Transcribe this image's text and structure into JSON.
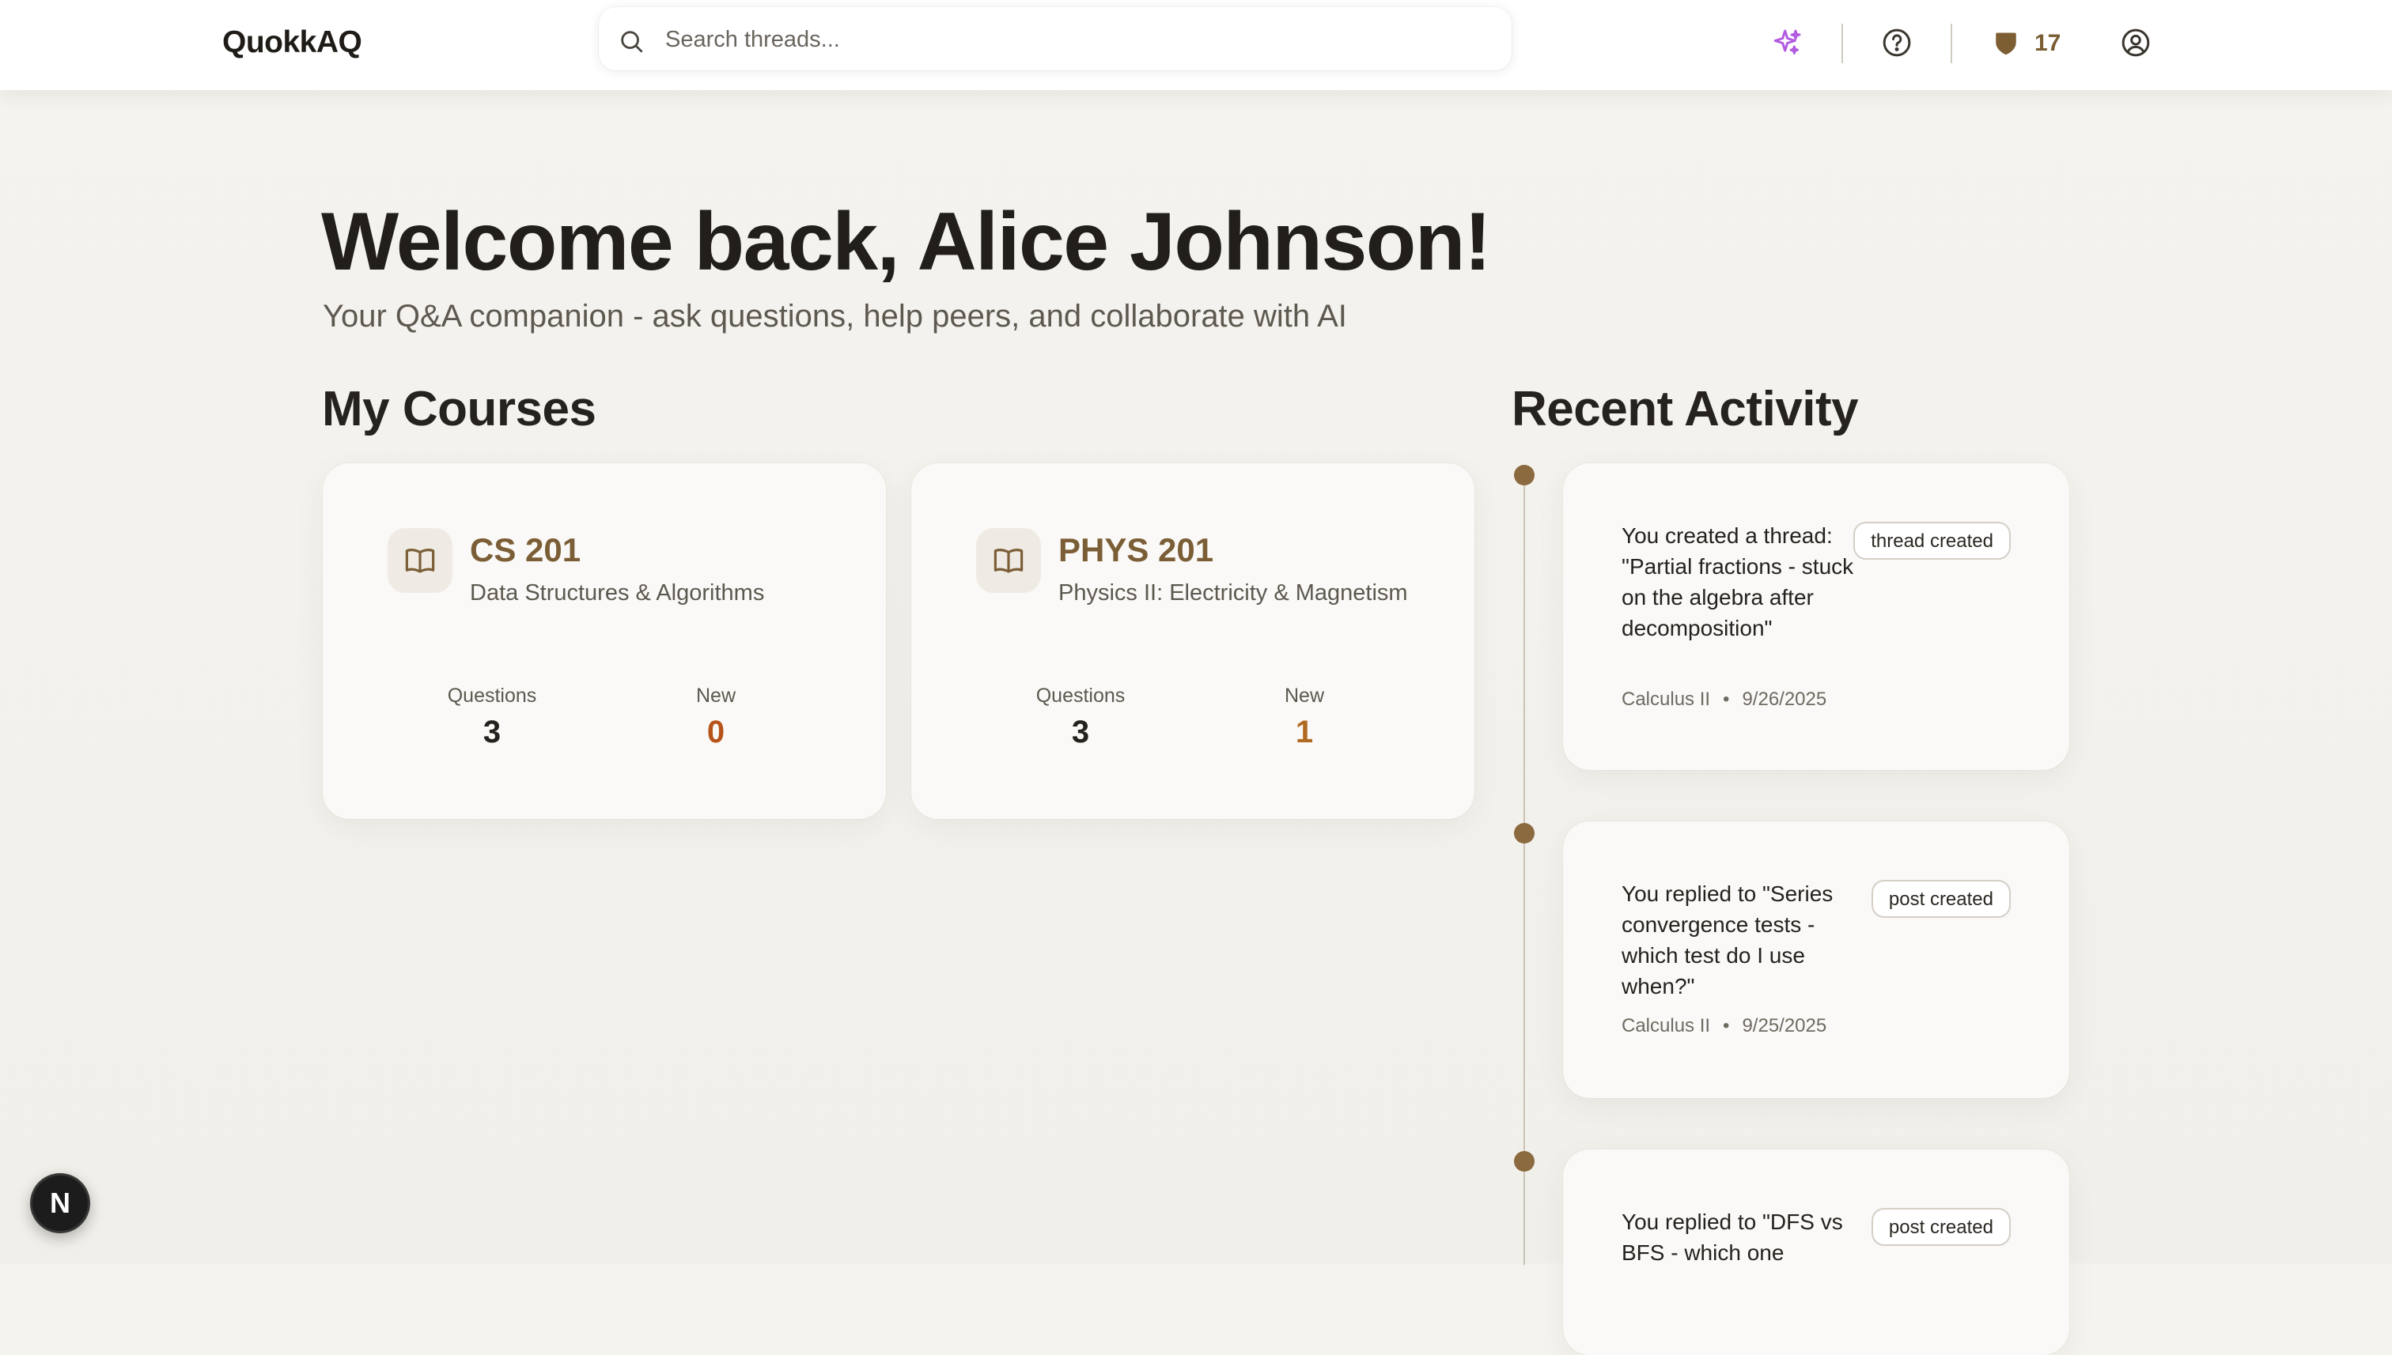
{
  "header": {
    "logo": "QuokkAQ",
    "search": {
      "placeholder": "Search threads...",
      "value": ""
    },
    "icons": [
      "sparkles-icon",
      "help-circle-icon",
      "shield-icon",
      "user-circle-icon"
    ],
    "points": "17"
  },
  "hero": {
    "title": "Welcome back, Alice Johnson!",
    "subtitle": "Your Q&A companion - ask questions, help peers, and collaborate with AI"
  },
  "courses": {
    "title": "My Courses",
    "items": [
      {
        "code": "CS 201",
        "name": "Data Structures & Algorithms",
        "questions_label": "Questions",
        "questions": "3",
        "new_label": "New",
        "new": "0"
      },
      {
        "code": "PHYS 201",
        "name": "Physics II: Electricity & Magnetism",
        "questions_label": "Questions",
        "questions": "3",
        "new_label": "New",
        "new": "1"
      }
    ]
  },
  "activity": {
    "title": "Recent Activity",
    "items": [
      {
        "text": "You created a thread: \"Partial fractions - stuck on the algebra after decomposition\"",
        "tag": "thread created",
        "course": "Calculus II",
        "separator": "•",
        "date": "9/26/2025"
      },
      {
        "text": "You replied to \"Series convergence tests - which test do I use when?\"",
        "tag": "post created",
        "course": "Calculus II",
        "separator": "•",
        "date": "9/25/2025"
      },
      {
        "text": "You replied to \"DFS vs BFS - which one",
        "tag": "post created"
      }
    ]
  },
  "dev_badge": "N",
  "colors": {
    "accent": "#7b5e36",
    "timeline_dot": "#8a6a3e",
    "new_count": "#b65318",
    "sparkle": "#b25be0"
  }
}
